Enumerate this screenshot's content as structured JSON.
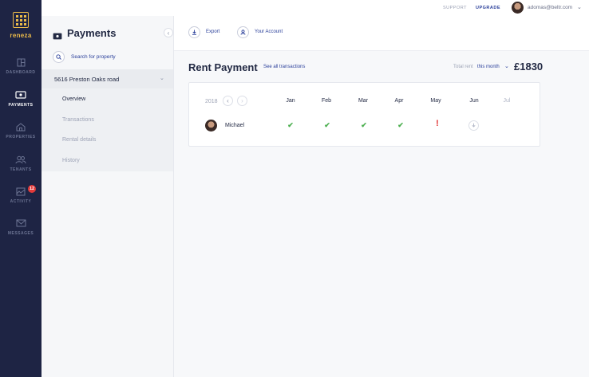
{
  "brand": {
    "name": "reneza",
    "accent_color": "#e9b949",
    "rail_color": "#1e2444"
  },
  "rail": {
    "items": [
      {
        "label": "DASHBOARD",
        "icon": "dashboard-icon",
        "active": false
      },
      {
        "label": "PAYMENTS",
        "icon": "payments-icon",
        "active": true
      },
      {
        "label": "PROPERTIES",
        "icon": "home-icon",
        "active": false
      },
      {
        "label": "TENANTS",
        "icon": "users-icon",
        "active": false
      },
      {
        "label": "ACTIVITY",
        "icon": "activity-icon",
        "active": false,
        "badge": "12"
      },
      {
        "label": "MESSAGES",
        "icon": "mail-icon",
        "active": false
      }
    ]
  },
  "topbar": {
    "support": "SUPPORT",
    "upgrade": "UPGRADE",
    "email": "adomas@beltr.com",
    "chevron_icon": "chevron-down-icon"
  },
  "subnav": {
    "title": "Payments",
    "title_icon": "payments-icon",
    "search_label": "Search for property",
    "property": "5616 Preston Oaks road",
    "items": [
      "Overview",
      "Transactions",
      "Rental details",
      "History"
    ],
    "active_item": "Overview"
  },
  "actions": {
    "export": "Export",
    "account": "Your Account"
  },
  "rent": {
    "title": "Rent Payment",
    "all_link": "See all transactions",
    "total_label": "Total rent",
    "period": "this month",
    "amount": "£1830"
  },
  "table": {
    "year": "2018",
    "months": [
      "Jan",
      "Feb",
      "Mar",
      "Apr",
      "May",
      "Jun",
      "Jul"
    ],
    "tenant": "Michael",
    "statuses": [
      "paid",
      "paid",
      "paid",
      "paid",
      "late",
      "pending",
      "none"
    ],
    "status_colors": {
      "paid": "#4caf50",
      "late": "#e23a3a"
    }
  }
}
